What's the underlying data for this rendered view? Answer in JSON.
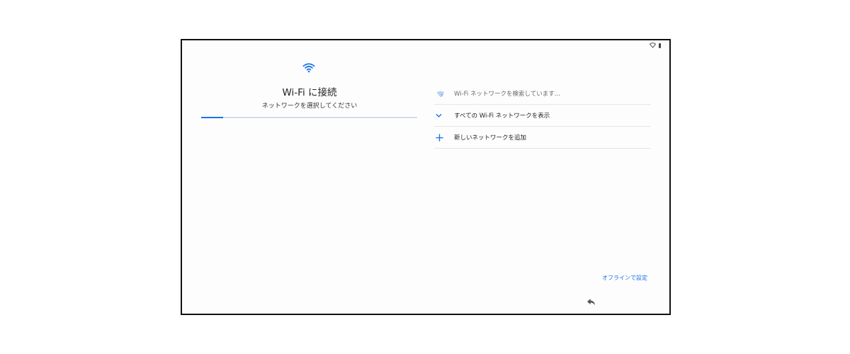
{
  "header": {
    "title": "Wi-Fi に接続",
    "subtitle": "ネットワークを選択してください"
  },
  "progress": {
    "fraction": 0.1
  },
  "network_list": {
    "items": [
      {
        "icon": "wifi-searching-icon",
        "label": "Wi-Fi ネットワークを検索しています..."
      },
      {
        "icon": "chevron-down-icon",
        "label": "すべての Wi-Fi ネットワークを表示"
      },
      {
        "icon": "plus-icon",
        "label": "新しいネットワークを追加"
      }
    ]
  },
  "footer": {
    "offline_label": "オフラインで設定"
  },
  "navigation": {
    "back_icon": "back-arrow-icon"
  },
  "status_bar": {
    "icons": [
      "wifi-status-icon",
      "battery-icon"
    ]
  },
  "colors": {
    "accent": "#1a73e8",
    "progress_track": "#d4dde8",
    "divider": "#e6e6e6"
  }
}
